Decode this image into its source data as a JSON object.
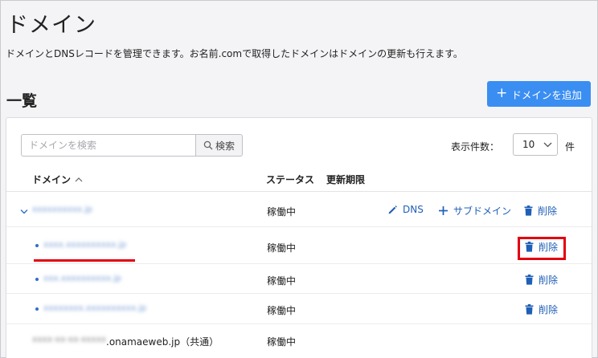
{
  "page": {
    "title": "ドメイン",
    "description": "ドメインとDNSレコードを管理できます。お名前.comで取得したドメインはドメインの更新も行えます。",
    "section_title": "一覧",
    "add_button_label": "ドメインを追加"
  },
  "search": {
    "placeholder": "ドメインを検索",
    "value": "",
    "button_label": "検索"
  },
  "pagination": {
    "per_page_label": "表示件数：",
    "per_page_value": "10",
    "per_page_unit": "件"
  },
  "table": {
    "headers": {
      "domain": "ドメイン",
      "status": "ステータス",
      "expiration": "更新期限"
    },
    "rows": [
      {
        "domain": "xxxxxxxxxx.jp",
        "status": "稼働中",
        "actions": {
          "dns": "DNS",
          "subdomain": "サブドメイン",
          "delete": "削除"
        }
      },
      {
        "domain": "xxxx.xxxxxxxxxx.jp",
        "status": "稼働中",
        "actions": {
          "delete": "削除"
        }
      },
      {
        "domain": "xxx.xxxxxxxxxx.jp",
        "status": "稼働中",
        "actions": {
          "delete": "削除"
        }
      },
      {
        "domain": "xxxxxxxx.xxxxxxxxxx.jp",
        "status": "稼働中",
        "actions": {
          "delete": "削除"
        }
      },
      {
        "domain_blurred": "xxxx-xx-xx-xxxxx",
        "domain_suffix": ".onamaeweb.jp（共通）",
        "status": "稼働中"
      }
    ]
  },
  "colors": {
    "primary": "#3a8ef2",
    "link": "#1f5fb5",
    "highlight": "#e3000f",
    "background": "#f4f4f6"
  },
  "icons": {
    "add": "plus-icon",
    "search": "magnifier-icon",
    "sort": "chevron-up-icon",
    "select": "chevron-down-icon",
    "expand": "chevron-down-icon",
    "dns": "pencil-icon",
    "subdomain": "plus-icon",
    "delete": "trash-icon"
  }
}
